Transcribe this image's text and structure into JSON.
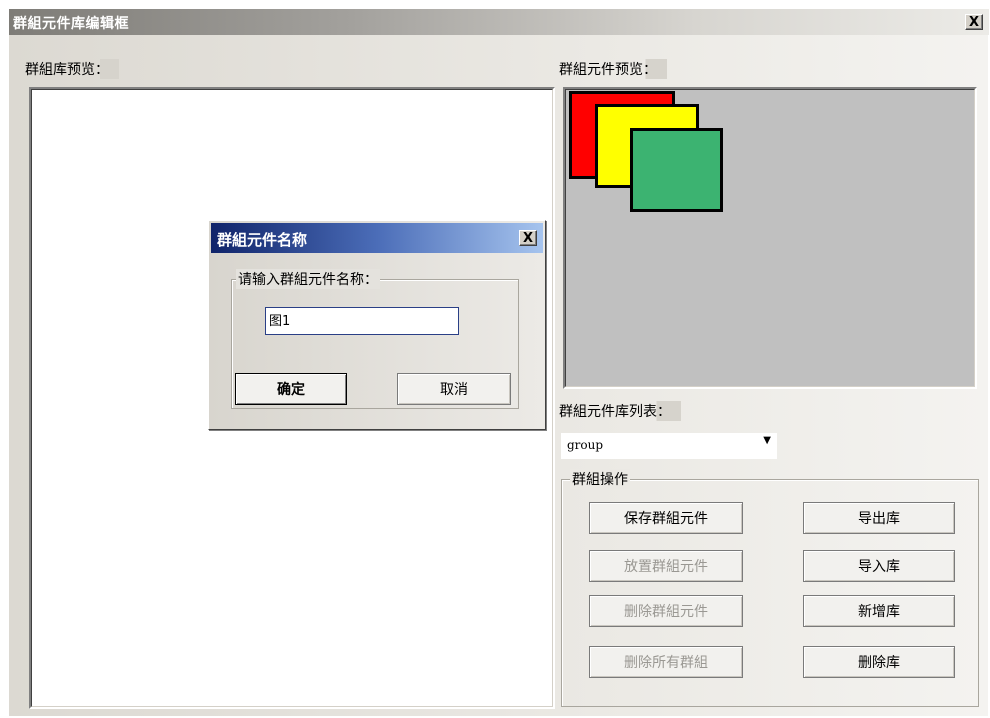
{
  "window": {
    "title": "群組元件库编辑框",
    "close_label": "X"
  },
  "left_panel": {
    "label": "群組库预览："
  },
  "right_panel": {
    "preview_label": "群組元件预览：",
    "preview": {
      "squares": [
        {
          "color": "#ff0000"
        },
        {
          "color": "#ffff00"
        },
        {
          "color": "#3cb371"
        }
      ]
    },
    "list_label": "群組元件库列表：",
    "library_select": {
      "value": "group"
    },
    "operations": {
      "title": "群組操作",
      "buttons": {
        "save_group": "保存群組元件",
        "place_group": "放置群組元件",
        "delete_group": "删除群組元件",
        "delete_all_groups": "删除所有群組",
        "export_lib": "导出库",
        "import_lib": "导入库",
        "new_lib": "新增库",
        "delete_lib": "删除库"
      }
    }
  },
  "dialog": {
    "title": "群組元件名称",
    "close_label": "X",
    "group_label": "请输入群組元件名称：",
    "input_value": "图1",
    "ok_label": "确定",
    "cancel_label": "取消"
  }
}
